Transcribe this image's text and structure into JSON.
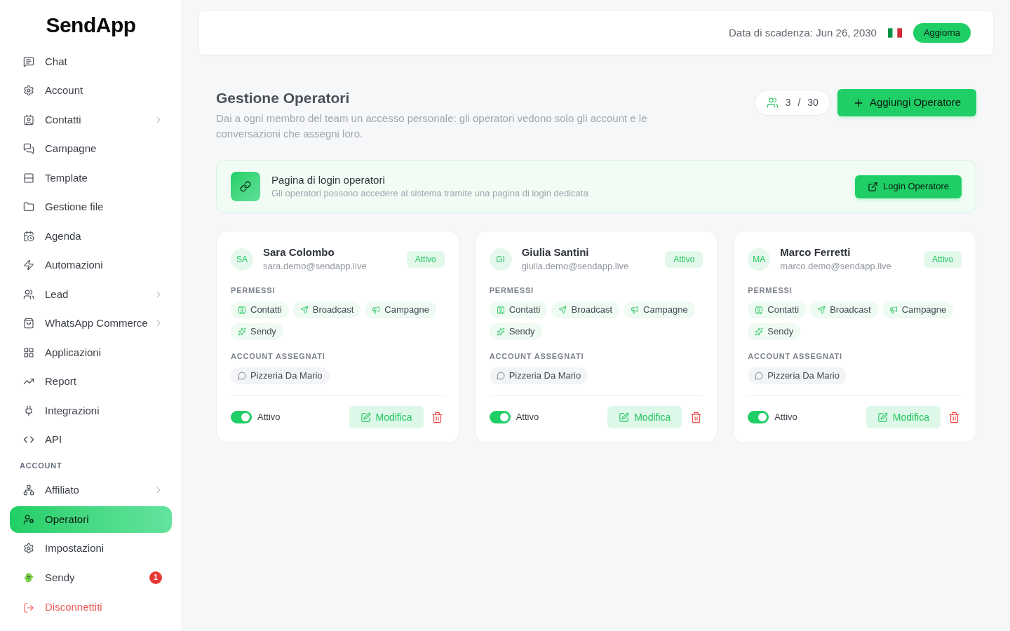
{
  "sidebar": {
    "logo": "SendApp",
    "sections": [
      {
        "items": [
          {
            "label": "Chat",
            "selected": false,
            "expandable": false
          },
          {
            "label": "Account",
            "selected": false,
            "expandable": false
          },
          {
            "label": "Contatti",
            "selected": false,
            "expandable": true
          },
          {
            "label": "Campagne",
            "selected": false,
            "expandable": false
          },
          {
            "label": "Template",
            "selected": false,
            "expandable": false
          },
          {
            "label": "Gestione file",
            "selected": false,
            "expandable": false
          },
          {
            "label": "Agenda",
            "selected": false,
            "expandable": false
          },
          {
            "label": "Automazioni",
            "selected": false,
            "expandable": false
          },
          {
            "label": "Lead",
            "selected": false,
            "expandable": true
          },
          {
            "label": "WhatsApp Commerce",
            "selected": false,
            "expandable": true
          },
          {
            "label": "Applicazioni",
            "selected": false,
            "expandable": false
          },
          {
            "label": "Report",
            "selected": false,
            "expandable": false
          },
          {
            "label": "Integrazioni",
            "selected": false,
            "expandable": false
          },
          {
            "label": "API",
            "selected": false,
            "expandable": false
          }
        ]
      },
      {
        "heading": "ACCOUNT",
        "items": [
          {
            "label": "Affiliato",
            "selected": false,
            "expandable": true
          },
          {
            "label": "Operatori",
            "selected": true,
            "expandable": false
          },
          {
            "label": "Impostazioni",
            "selected": false,
            "expandable": false
          },
          {
            "label": "Sendy",
            "selected": false,
            "expandable": false,
            "badge": "1"
          }
        ]
      }
    ],
    "logout": "Disconnettiti"
  },
  "header": {
    "expiry": "Data di scadenza: Jun 26, 2030",
    "upgrade_button": "Aggiorna"
  },
  "page": {
    "title": "Gestione Operatori",
    "description": "Dai a ogni membro del team un accesso personale: gli operatori vedono solo gli account e le conversazioni che assegni loro.",
    "operator_count": {
      "used": "3",
      "separator": "/",
      "limit": "30"
    },
    "add_button": "Aggiungi Operatore"
  },
  "login_banner": {
    "title": "Pagina di login operatori",
    "subtitle": "Gli operatori possono accedere al sistema tramite una pagina di login dedicata",
    "button": "Login Operatore"
  },
  "operators": [
    {
      "initials": "SA",
      "name": "Sara Colombo",
      "email": "sara.demo@sendapp.live",
      "status": "Attivo",
      "permissions_label": "PERMESSI",
      "permissions": [
        {
          "label": "Contatti",
          "kind": "contacts"
        },
        {
          "label": "Broadcast",
          "kind": "broadcast"
        },
        {
          "label": "Campagne",
          "kind": "campaigns"
        },
        {
          "label": "Sendy",
          "kind": "assistant"
        }
      ],
      "accounts_label": "ACCOUNT ASSEGNATI",
      "accounts": [
        "Pizzeria Da Mario"
      ],
      "active": true,
      "active_label": "Attivo",
      "edit_button": "Modifica"
    },
    {
      "initials": "GI",
      "name": "Giulia Santini",
      "email": "giulia.demo@sendapp.live",
      "status": "Attivo",
      "permissions_label": "PERMESSI",
      "permissions": [
        {
          "label": "Contatti",
          "kind": "contacts"
        },
        {
          "label": "Broadcast",
          "kind": "broadcast"
        },
        {
          "label": "Campagne",
          "kind": "campaigns"
        },
        {
          "label": "Sendy",
          "kind": "assistant"
        }
      ],
      "accounts_label": "ACCOUNT ASSEGNATI",
      "accounts": [
        "Pizzeria Da Mario"
      ],
      "active": true,
      "active_label": "Attivo",
      "edit_button": "Modifica"
    },
    {
      "initials": "MA",
      "name": "Marco Ferretti",
      "email": "marco.demo@sendapp.live",
      "status": "Attivo",
      "permissions_label": "PERMESSI",
      "permissions": [
        {
          "label": "Contatti",
          "kind": "contacts"
        },
        {
          "label": "Broadcast",
          "kind": "broadcast"
        },
        {
          "label": "Campagne",
          "kind": "campaigns"
        },
        {
          "label": "Sendy",
          "kind": "assistant"
        }
      ],
      "accounts_label": "ACCOUNT ASSEGNATI",
      "accounts": [
        "Pizzeria Da Mario"
      ],
      "active": true,
      "active_label": "Attivo",
      "edit_button": "Modifica"
    }
  ]
}
